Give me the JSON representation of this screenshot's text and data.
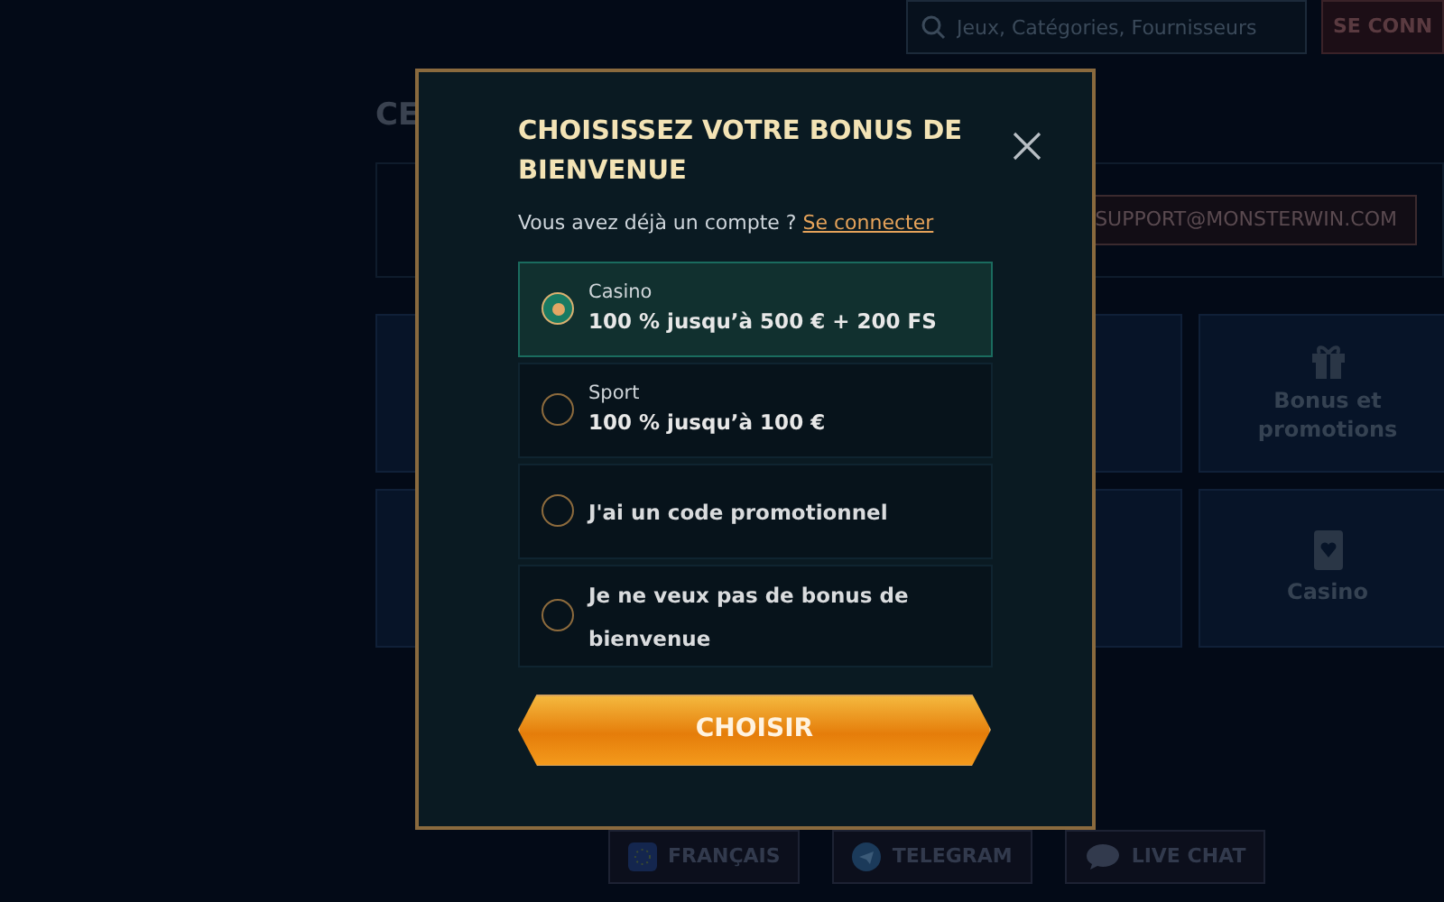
{
  "header": {
    "search": {
      "placeholder": "Jeux, Catégories, Fournisseurs"
    },
    "login_button": "SE CONN"
  },
  "page": {
    "heading": "CE",
    "support_email": "SUPPORT@MONSTERWIN.COM",
    "tiles": [
      {
        "label": "Bonus et promotions"
      },
      {
        "label": "Casino"
      }
    ]
  },
  "footer_buttons": [
    {
      "label": "FRANÇAIS"
    },
    {
      "label": "TELEGRAM"
    },
    {
      "label": "LIVE CHAT"
    }
  ],
  "modal": {
    "title": "CHOISISSEZ VOTRE BONUS DE BIENVENUE",
    "account_prompt": "Vous avez déjà un compte ?",
    "login_link": "Se connecter",
    "options": [
      {
        "category": "Casino",
        "offer": "100 % jusqu’à 500 € + 200 FS",
        "selected": true
      },
      {
        "category": "Sport",
        "offer": "100 % jusqu’à 100 €",
        "selected": false
      },
      {
        "offer": "J'ai un code promotionnel",
        "selected": false
      },
      {
        "offer": "Je ne veux pas de bonus de bienvenue",
        "selected": false
      }
    ],
    "submit_button": "CHOISIR"
  }
}
